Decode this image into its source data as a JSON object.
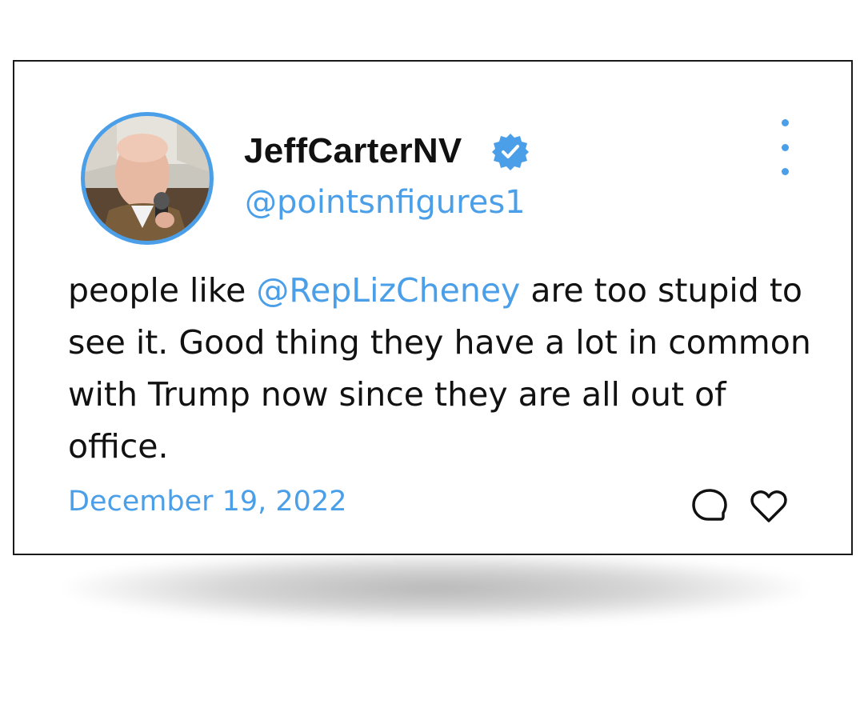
{
  "tweet": {
    "display_name": "JeffCarterNV",
    "handle": "@pointsnfigures1",
    "verified": true,
    "text_before": "people like ",
    "mention": "@RepLizCheney",
    "text_after": " are too stupid to see it. Good thing they have a lot in common with Trump now since they are all out of office.",
    "date": "December 19, 2022"
  },
  "icons": {
    "verified": "verified-badge-icon",
    "more": "more-vertical-icon",
    "reply": "speech-bubble-icon",
    "like": "heart-icon"
  },
  "colors": {
    "accent": "#4a9fe8",
    "text": "#111111",
    "border": "#1a1a1a"
  }
}
